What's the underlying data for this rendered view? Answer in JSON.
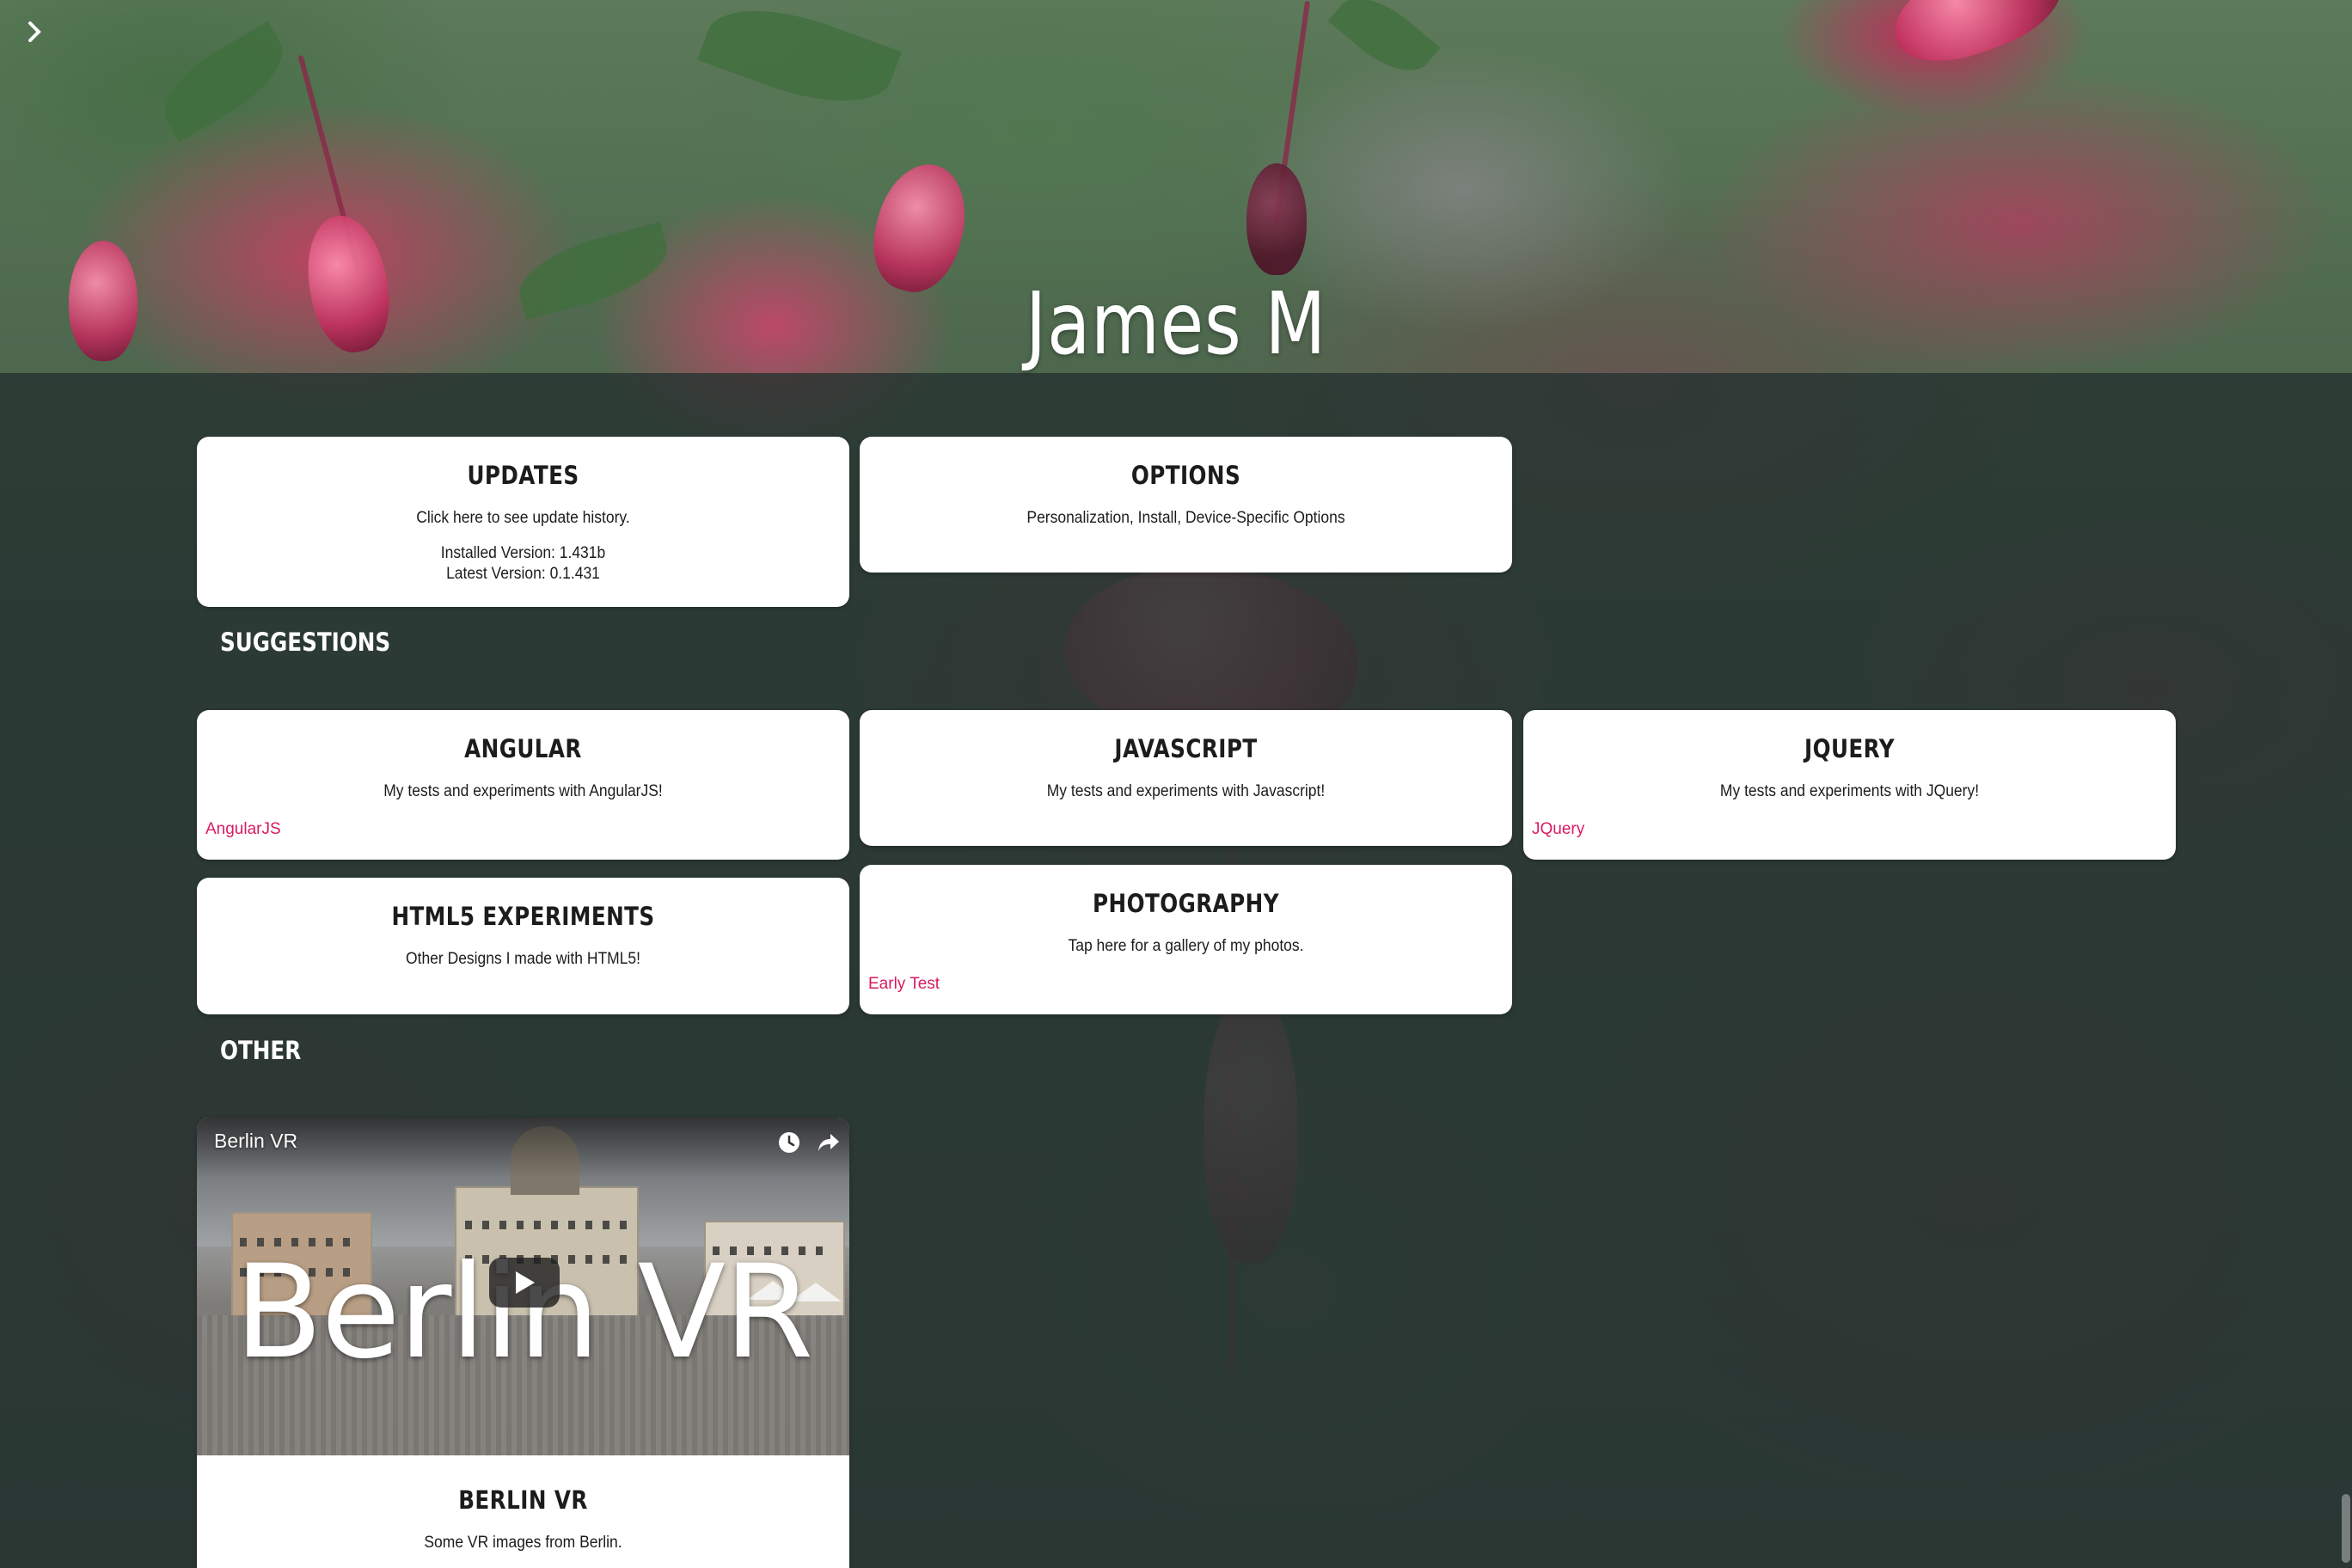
{
  "header": {
    "menu_icon": "chevron-right-icon",
    "title": "James M"
  },
  "cards_top": {
    "updates": {
      "title": "UPDATES",
      "desc": "Click here to see update history.",
      "installed": "Installed Version: 1.431b",
      "latest": "Latest Version: 0.1.431"
    },
    "options": {
      "title": "OPTIONS",
      "desc": "Personalization, Install, Device-Specific Options"
    }
  },
  "suggestions": {
    "heading": "SUGGESTIONS",
    "angular": {
      "title": "ANGULAR",
      "desc": "My tests and experiments with AngularJS!",
      "tag": "AngularJS"
    },
    "javascript": {
      "title": "JAVASCRIPT",
      "desc": "My tests and experiments with Javascript!"
    },
    "jquery": {
      "title": "JQUERY",
      "desc": "My tests and experiments with JQuery!",
      "tag": "JQuery"
    },
    "html5": {
      "title": "HTML5 EXPERIMENTS",
      "desc": "Other Designs I made with HTML5!"
    },
    "photography": {
      "title": "PHOTOGRAPHY",
      "desc": "Tap here for a gallery of my photos.",
      "tag": "Early Test"
    }
  },
  "other": {
    "heading": "OTHER",
    "berlin": {
      "video_label": "Berlin VR",
      "video_overlay_text": "Berlin VR",
      "watch_later_icon": "clock-icon",
      "share_icon": "share-icon",
      "play_icon": "play-icon",
      "title": "BERLIN VR",
      "desc": "Some VR images from Berlin."
    }
  },
  "colors": {
    "tag": "#d81b60",
    "card_bg": "#ffffff",
    "overlay": "#263230"
  }
}
